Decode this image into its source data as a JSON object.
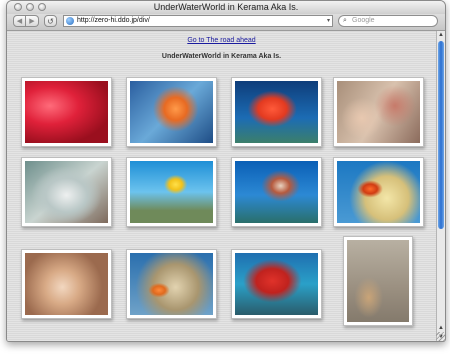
{
  "window": {
    "title": "UnderWaterWorld in Kerama Aka Is."
  },
  "toolbar": {
    "back_icon": "◀",
    "forward_icon": "▶",
    "reload_icon": "↺",
    "url": "http://zero-hi.ddo.jp/div/",
    "search_placeholder": "Google"
  },
  "page": {
    "link_text": "Go to The road ahead",
    "heading": "UnderWaterWorld in Kerama Aka Is."
  },
  "gallery": [
    {
      "style": "p1",
      "orientation": "landscape"
    },
    {
      "style": "p2",
      "orientation": "landscape"
    },
    {
      "style": "p3",
      "orientation": "landscape"
    },
    {
      "style": "p4",
      "orientation": "landscape"
    },
    {
      "style": "p5",
      "orientation": "landscape"
    },
    {
      "style": "p6",
      "orientation": "landscape"
    },
    {
      "style": "p7",
      "orientation": "landscape"
    },
    {
      "style": "p8",
      "orientation": "landscape"
    },
    {
      "style": "p9",
      "orientation": "landscape"
    },
    {
      "style": "p10",
      "orientation": "landscape"
    },
    {
      "style": "p11",
      "orientation": "landscape"
    },
    {
      "style": "p12",
      "orientation": "portrait"
    }
  ]
}
